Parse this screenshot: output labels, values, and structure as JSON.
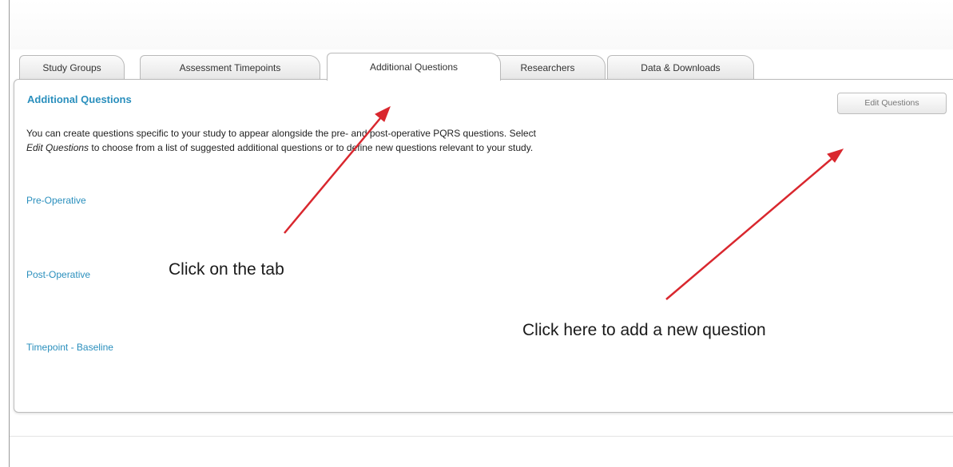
{
  "tabs": [
    {
      "label": "Study Groups"
    },
    {
      "label": "Assessment Timepoints"
    },
    {
      "label": "Additional Questions",
      "active": true
    },
    {
      "label": "Researchers"
    },
    {
      "label": "Data & Downloads"
    }
  ],
  "panel": {
    "title": "Additional Questions",
    "edit_button_label": "Edit Questions",
    "intro_line1": "You can create questions specific to your study to appear alongside the pre- and post-operative PQRS questions. Select",
    "intro_emphasis": "Edit Questions",
    "intro_line2_rest": " to choose from a list of suggested additional questions or to define new questions relevant to your study.",
    "sections": [
      {
        "label": "Pre-Operative"
      },
      {
        "label": "Post-Operative"
      },
      {
        "label": "Timepoint - Baseline"
      }
    ]
  },
  "annotations": {
    "tab_hint": "Click on the tab",
    "button_hint": "Click here to add a new question",
    "arrow_color": "#d9272e"
  },
  "colors": {
    "link": "#2a8fbd",
    "annotation_arrow": "#d9272e"
  }
}
